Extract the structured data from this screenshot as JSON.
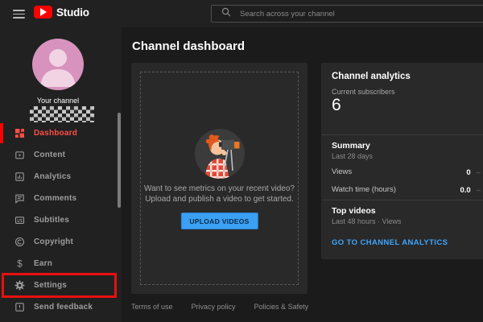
{
  "topbar": {
    "brand": "Studio",
    "search_placeholder": "Search across your channel"
  },
  "sidebar": {
    "your_channel_label": "Your channel",
    "items": [
      {
        "label": "Dashboard",
        "active": true
      },
      {
        "label": "Content"
      },
      {
        "label": "Analytics"
      },
      {
        "label": "Comments"
      },
      {
        "label": "Subtitles"
      },
      {
        "label": "Copyright"
      },
      {
        "label": "Earn"
      },
      {
        "label": "Settings",
        "highlighted": true
      },
      {
        "label": "Send feedback"
      }
    ]
  },
  "main": {
    "title": "Channel dashboard",
    "upload_card": {
      "line1": "Want to see metrics on your recent video?",
      "line2": "Upload and publish a video to get started.",
      "button_label": "UPLOAD VIDEOS"
    },
    "analytics_card": {
      "title": "Channel analytics",
      "subscribers_label": "Current subscribers",
      "subscribers_value": "6",
      "summary_title": "Summary",
      "summary_period": "Last 28 days",
      "rows": [
        {
          "label": "Views",
          "value": "0",
          "trend": "–"
        },
        {
          "label": "Watch time (hours)",
          "value": "0.0",
          "trend": "–"
        }
      ],
      "top_videos_title": "Top videos",
      "top_videos_period": "Last 48 hours · Views",
      "link_label": "GO TO CHANNEL ANALYTICS"
    },
    "footer_links": [
      "Terms of use",
      "Privacy policy",
      "Policies & Safety"
    ]
  },
  "colors": {
    "youtube_red": "#ff0000",
    "active_item_red": "#ff4e45",
    "annotation_red": "#e90f0f",
    "button_blue": "#3aa0f4",
    "link_blue": "#3ea6ff"
  }
}
